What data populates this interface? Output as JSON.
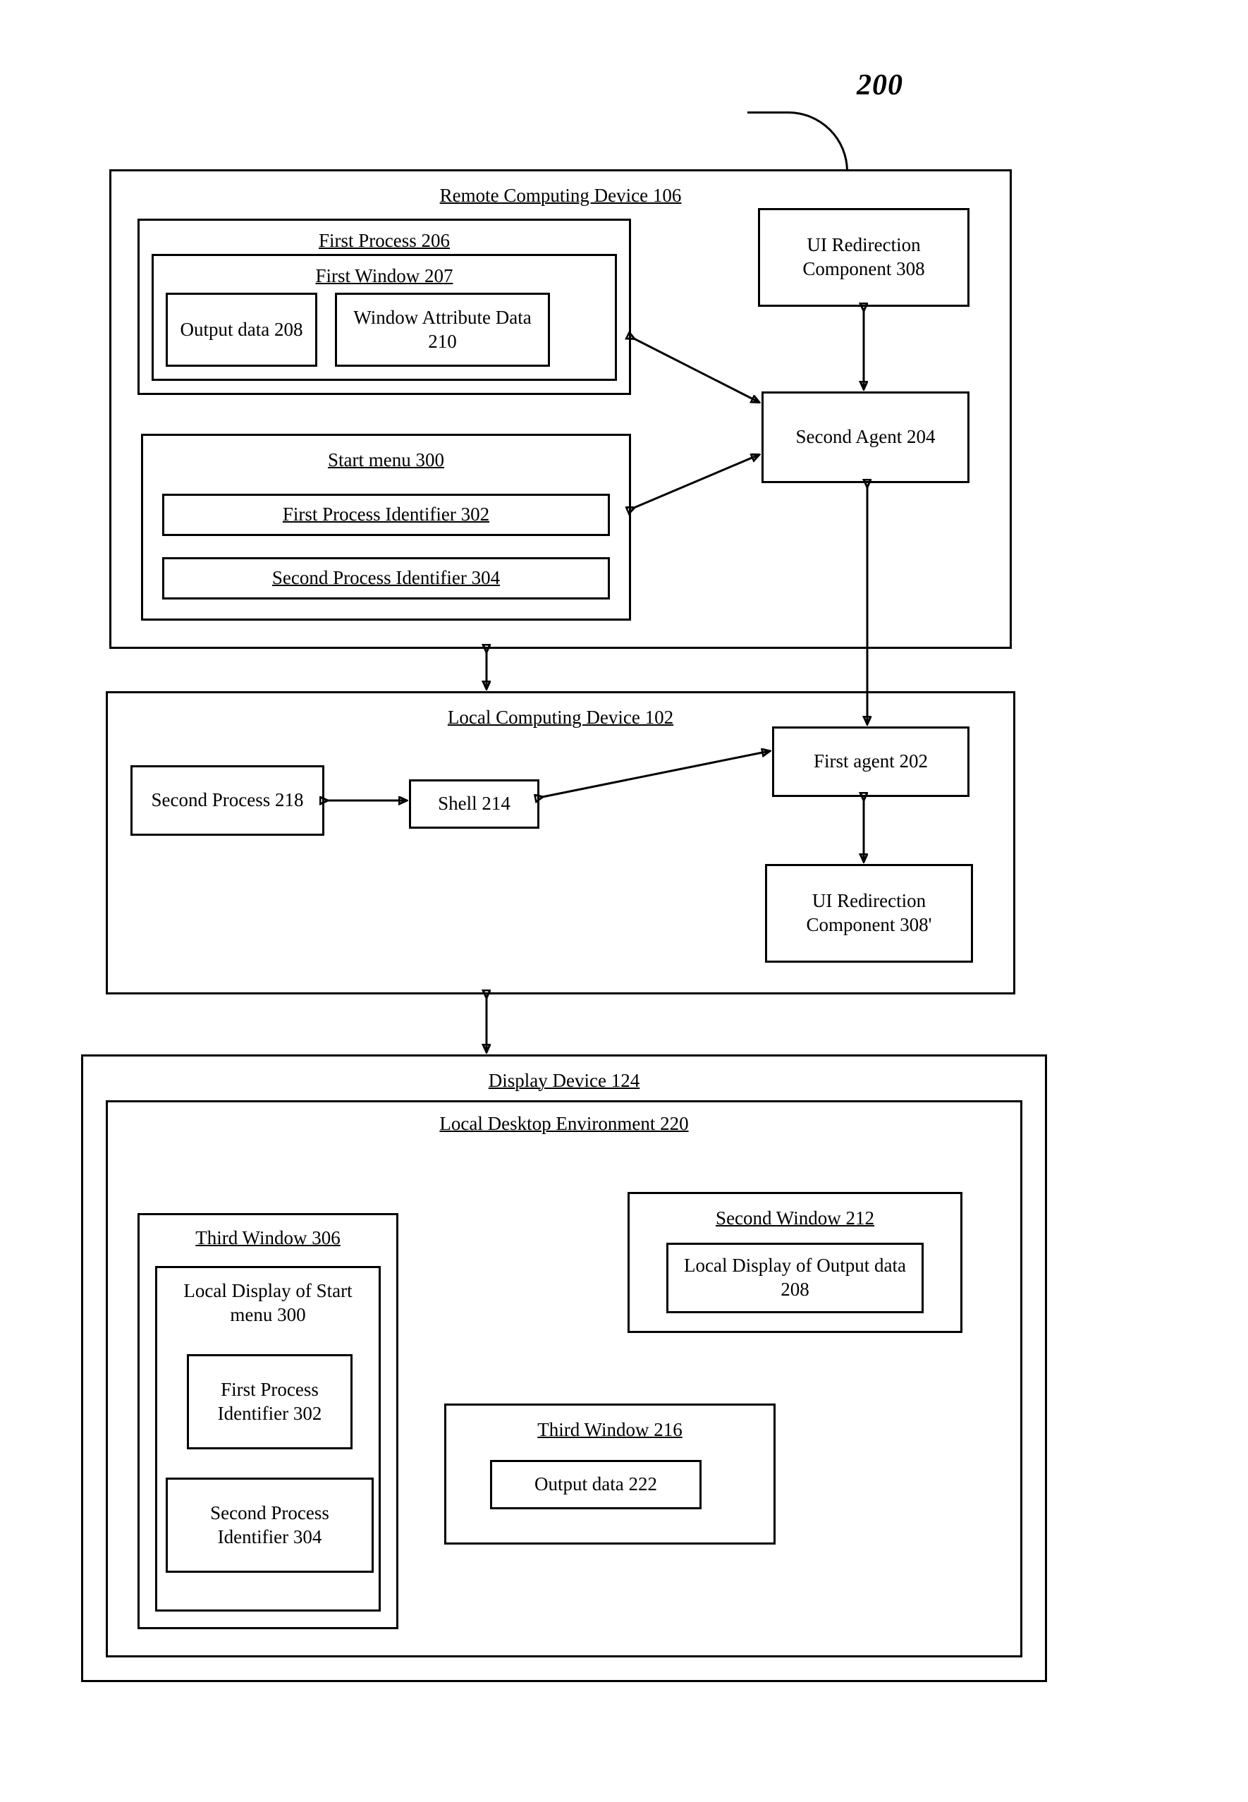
{
  "figure": {
    "label": "200"
  },
  "remote": {
    "title": "Remote Computing Device 106",
    "first_process": {
      "title": "First Process 206",
      "first_window": {
        "title": "First Window 207",
        "output_data": "Output data 208",
        "window_attr": "Window Attribute Data 210"
      }
    },
    "start_menu": {
      "title": "Start menu 300",
      "first_proc_id": "First Process Identifier 302",
      "second_proc_id": "Second Process Identifier 304"
    },
    "ui_redir": "UI Redirection Component 308",
    "second_agent": "Second Agent 204"
  },
  "local": {
    "title": "Local Computing Device 102",
    "second_process": "Second Process 218",
    "shell": "Shell 214",
    "first_agent": "First agent 202",
    "ui_redir": "UI Redirection Component 308'"
  },
  "display": {
    "title": "Display Device 124",
    "env": {
      "title": "Local Desktop Environment 220",
      "third_window_a": {
        "title": "Third Window 306",
        "local_display": "Local Display of Start menu 300",
        "first_proc_id": "First Process Identifier 302",
        "second_proc_id": "Second Process Identifier 304"
      },
      "second_window": {
        "title": "Second Window 212",
        "local_output": "Local Display of Output data 208"
      },
      "third_window_b": {
        "title": "Third Window 216",
        "output_data": "Output data 222"
      }
    }
  }
}
